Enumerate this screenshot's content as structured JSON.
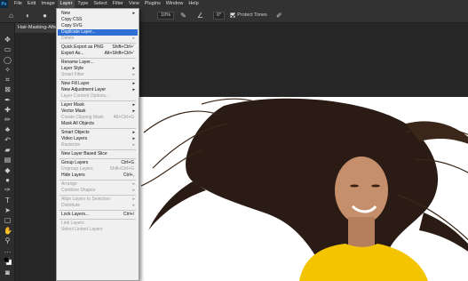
{
  "menubar": {
    "items": [
      {
        "label": "File"
      },
      {
        "label": "Edit"
      },
      {
        "label": "Image"
      },
      {
        "label": "Layer",
        "active": true
      },
      {
        "label": "Type"
      },
      {
        "label": "Select"
      },
      {
        "label": "Filter"
      },
      {
        "label": "View"
      },
      {
        "label": "Plugins"
      },
      {
        "label": "Window"
      },
      {
        "label": "Help"
      }
    ]
  },
  "options_bar": {
    "zoom_value": "10%",
    "angle_value": "0°",
    "protect_tones_label": "Protect Tones"
  },
  "document_tab": {
    "title": "Hair-Masking-Afte"
  },
  "layer_menu": {
    "items": [
      {
        "label": "New",
        "submenu": true
      },
      {
        "label": "Copy CSS"
      },
      {
        "label": "Copy SVG"
      },
      {
        "label": "Duplicate Layer...",
        "highlighted": true
      },
      {
        "label": "Delete",
        "submenu": true,
        "disabled": true
      },
      {
        "sep": true
      },
      {
        "label": "Quick Export as PNG",
        "shortcut": "Shift+Ctrl+'"
      },
      {
        "label": "Export As...",
        "shortcut": "Alt+Shift+Ctrl+'"
      },
      {
        "sep": true
      },
      {
        "label": "Rename Layer..."
      },
      {
        "label": "Layer Style",
        "submenu": true
      },
      {
        "label": "Smart Filter",
        "submenu": true,
        "disabled": true
      },
      {
        "sep": true
      },
      {
        "label": "New Fill Layer",
        "submenu": true
      },
      {
        "label": "New Adjustment Layer",
        "submenu": true
      },
      {
        "label": "Layer Content Options...",
        "disabled": true
      },
      {
        "sep": true
      },
      {
        "label": "Layer Mask",
        "submenu": true
      },
      {
        "label": "Vector Mask",
        "submenu": true
      },
      {
        "label": "Create Clipping Mask",
        "shortcut": "Alt+Ctrl+G",
        "disabled": true
      },
      {
        "label": "Mask All Objects"
      },
      {
        "sep": true
      },
      {
        "label": "Smart Objects",
        "submenu": true
      },
      {
        "label": "Video Layers",
        "submenu": true
      },
      {
        "label": "Rasterize",
        "submenu": true,
        "disabled": true
      },
      {
        "sep": true
      },
      {
        "label": "New Layer Based Slice"
      },
      {
        "sep": true
      },
      {
        "label": "Group Layers",
        "shortcut": "Ctrl+G"
      },
      {
        "label": "Ungroup Layers",
        "shortcut": "Shift+Ctrl+G",
        "disabled": true
      },
      {
        "label": "Hide Layers",
        "shortcut": "Ctrl+,"
      },
      {
        "sep": true
      },
      {
        "label": "Arrange",
        "submenu": true,
        "disabled": true
      },
      {
        "label": "Combine Shapes",
        "submenu": true,
        "disabled": true
      },
      {
        "sep": true
      },
      {
        "label": "Align Layers to Selection",
        "submenu": true,
        "disabled": true
      },
      {
        "label": "Distribute",
        "submenu": true,
        "disabled": true
      },
      {
        "sep": true
      },
      {
        "label": "Lock Layers...",
        "shortcut": "Ctrl+/"
      },
      {
        "sep": true
      },
      {
        "label": "Link Layers",
        "disabled": true
      },
      {
        "label": "Select Linked Layers",
        "disabled": true
      }
    ]
  },
  "toolbar": {
    "tools": [
      "move-tool",
      "artboard-tool",
      "lasso-tool",
      "quick-selection-tool",
      "crop-tool",
      "frame-tool",
      "eyedropper-tool",
      "spot-healing-tool",
      "brush-tool",
      "clone-stamp-tool",
      "history-brush-tool",
      "eraser-tool",
      "gradient-tool",
      "blur-tool",
      "dodge-tool",
      "pen-tool",
      "type-tool",
      "path-selection-tool",
      "rectangle-tool",
      "hand-tool",
      "zoom-tool",
      "more-tools",
      "foreground-background-colors",
      "quick-mask-mode"
    ]
  },
  "colors": {
    "chrome_dark": "#262626",
    "panel": "#323232",
    "menu_bg": "#f0f0f0",
    "menu_highlight": "#2f6fd3",
    "shirt_yellow": "#f5c400",
    "hair": "#2a1c14",
    "skin": "#c58f6c"
  }
}
